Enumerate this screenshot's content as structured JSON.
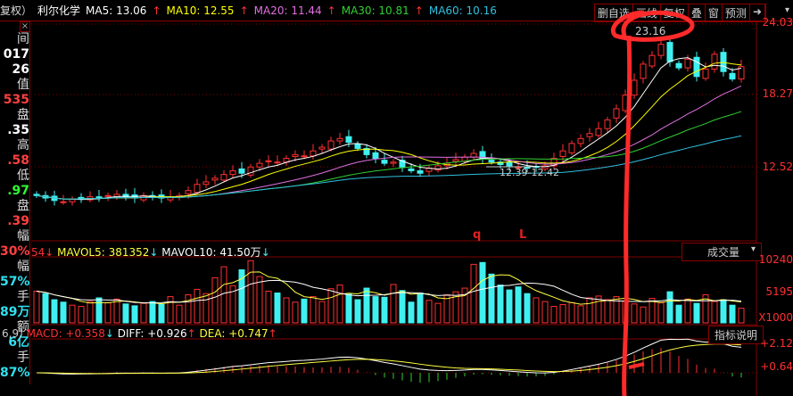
{
  "header": {
    "title_prefix": "复权）",
    "stock_name": "利尔化学",
    "ma": [
      {
        "label": "MA5: 13.06",
        "color": "#ffffff"
      },
      {
        "label": "MA10: 12.55",
        "color": "#ffff00"
      },
      {
        "label": "MA20: 11.44",
        "color": "#e070e0"
      },
      {
        "label": "MA30: 10.81",
        "color": "#30d030"
      },
      {
        "label": "MA60: 10.16",
        "color": "#30c0e0"
      }
    ],
    "up_arrow": "↑",
    "buttons": [
      "删自选",
      "画线",
      "复权",
      "叠",
      "窗",
      "预测"
    ],
    "next_icon": "➜",
    "dropdown": "▾"
  },
  "left_panel": {
    "close": "×",
    "rows": [
      {
        "t": "间",
        "c": "w"
      },
      {
        "t": "017",
        "c": "b"
      },
      {
        "t": "26",
        "c": "b"
      },
      {
        "t": "值",
        "c": "w"
      },
      {
        "t": "535",
        "c": "r"
      },
      {
        "t": "盘",
        "c": "w"
      },
      {
        "t": ".35",
        "c": "b"
      },
      {
        "t": "高",
        "c": "w"
      },
      {
        "t": ".58",
        "c": "r"
      },
      {
        "t": "低",
        "c": "w"
      },
      {
        "t": ".97",
        "c": "g"
      },
      {
        "t": "盘",
        "c": "w"
      },
      {
        "t": ".39",
        "c": "r"
      },
      {
        "t": "幅",
        "c": "w"
      },
      {
        "t": "30%",
        "c": "r"
      },
      {
        "t": "幅",
        "c": "w"
      },
      {
        "t": "57%",
        "c": "c"
      },
      {
        "t": "手",
        "c": "w"
      },
      {
        "t": "89万",
        "c": "c"
      },
      {
        "t": "额",
        "c": "w"
      },
      {
        "t": "6亿",
        "c": "c"
      },
      {
        "t": "手",
        "c": "w"
      },
      {
        "t": "87%",
        "c": "c"
      }
    ]
  },
  "price_axis": [
    "24.03",
    "18.27",
    "12.52"
  ],
  "price_range": [
    12.52,
    24.03
  ],
  "annotations": {
    "peak": "23.16",
    "range": "12.39-12.42",
    "mark_q": "q",
    "mark_l": "L"
  },
  "volume": {
    "prefix": "54↓",
    "mavol5": "MAVOL5: 381352",
    "mavol5_arrow": "↓",
    "mavol10": "MAVOL10: 41.50万",
    "mavol10_arrow": "↓",
    "selector": "成交量",
    "axis": [
      "10240",
      "5195",
      "X1000"
    ],
    "values": [
      5200,
      4800,
      3800,
      3400,
      2900,
      2700,
      3500,
      4100,
      3300,
      3900,
      3100,
      2800,
      3200,
      3500,
      3000,
      4300,
      2900,
      4600,
      5500,
      4800,
      7400,
      9200,
      6100,
      8700,
      10200,
      7600,
      5200,
      4900,
      4100,
      3400,
      3900,
      4300,
      3500,
      5600,
      6200,
      4700,
      3800,
      5700,
      4300,
      4200,
      6300,
      5300,
      3400,
      4900,
      3700,
      3200,
      4600,
      5100,
      5700,
      9600,
      9900,
      8000,
      6200,
      5400,
      5900,
      4800,
      4100,
      3500,
      2700,
      3000,
      3300,
      2800,
      4100,
      4400,
      3800,
      4300,
      3600,
      3100,
      2600,
      4000,
      3300,
      5100,
      2900,
      3900,
      3200,
      4600,
      3500,
      3800,
      2900,
      2400
    ]
  },
  "macd": {
    "prefix": "6,9)",
    "macd": "MACD: +0.358",
    "macd_arrow": "↓",
    "diff": "DIFF: +0.926",
    "diff_arrow": "↑",
    "dea": "DEA: +0.747",
    "dea_arrow": "↑",
    "explain": "指标说明",
    "axis": [
      "+2.12",
      "+0.64"
    ]
  },
  "candles": {
    "closes": [
      10.2,
      10.0,
      9.8,
      9.7,
      9.9,
      10.0,
      10.1,
      10.0,
      10.2,
      10.3,
      10.1,
      10.0,
      10.2,
      10.1,
      10.0,
      10.1,
      10.2,
      10.6,
      11.1,
      11.3,
      11.6,
      11.9,
      12.2,
      12.0,
      12.5,
      12.8,
      13.0,
      12.9,
      13.2,
      13.5,
      13.4,
      13.8,
      14.1,
      14.6,
      14.8,
      14.5,
      14.0,
      13.5,
      13.2,
      12.8,
      12.9,
      12.5,
      12.2,
      12.0,
      12.4,
      12.6,
      12.8,
      13.1,
      13.3,
      13.6,
      13.2,
      12.9,
      12.7,
      12.6,
      12.5,
      12.4,
      12.5,
      12.6,
      13.2,
      13.8,
      14.4,
      14.8,
      15.2,
      15.6,
      16.3,
      17.2,
      18.3,
      19.5,
      20.8,
      21.5,
      22.4,
      21.0,
      20.5,
      21.2,
      19.8,
      20.4,
      21.6,
      20.2,
      19.6,
      20.6
    ]
  },
  "colors": {
    "up": "#ff3030",
    "down": "#40f0f0",
    "grid": "#800000"
  }
}
